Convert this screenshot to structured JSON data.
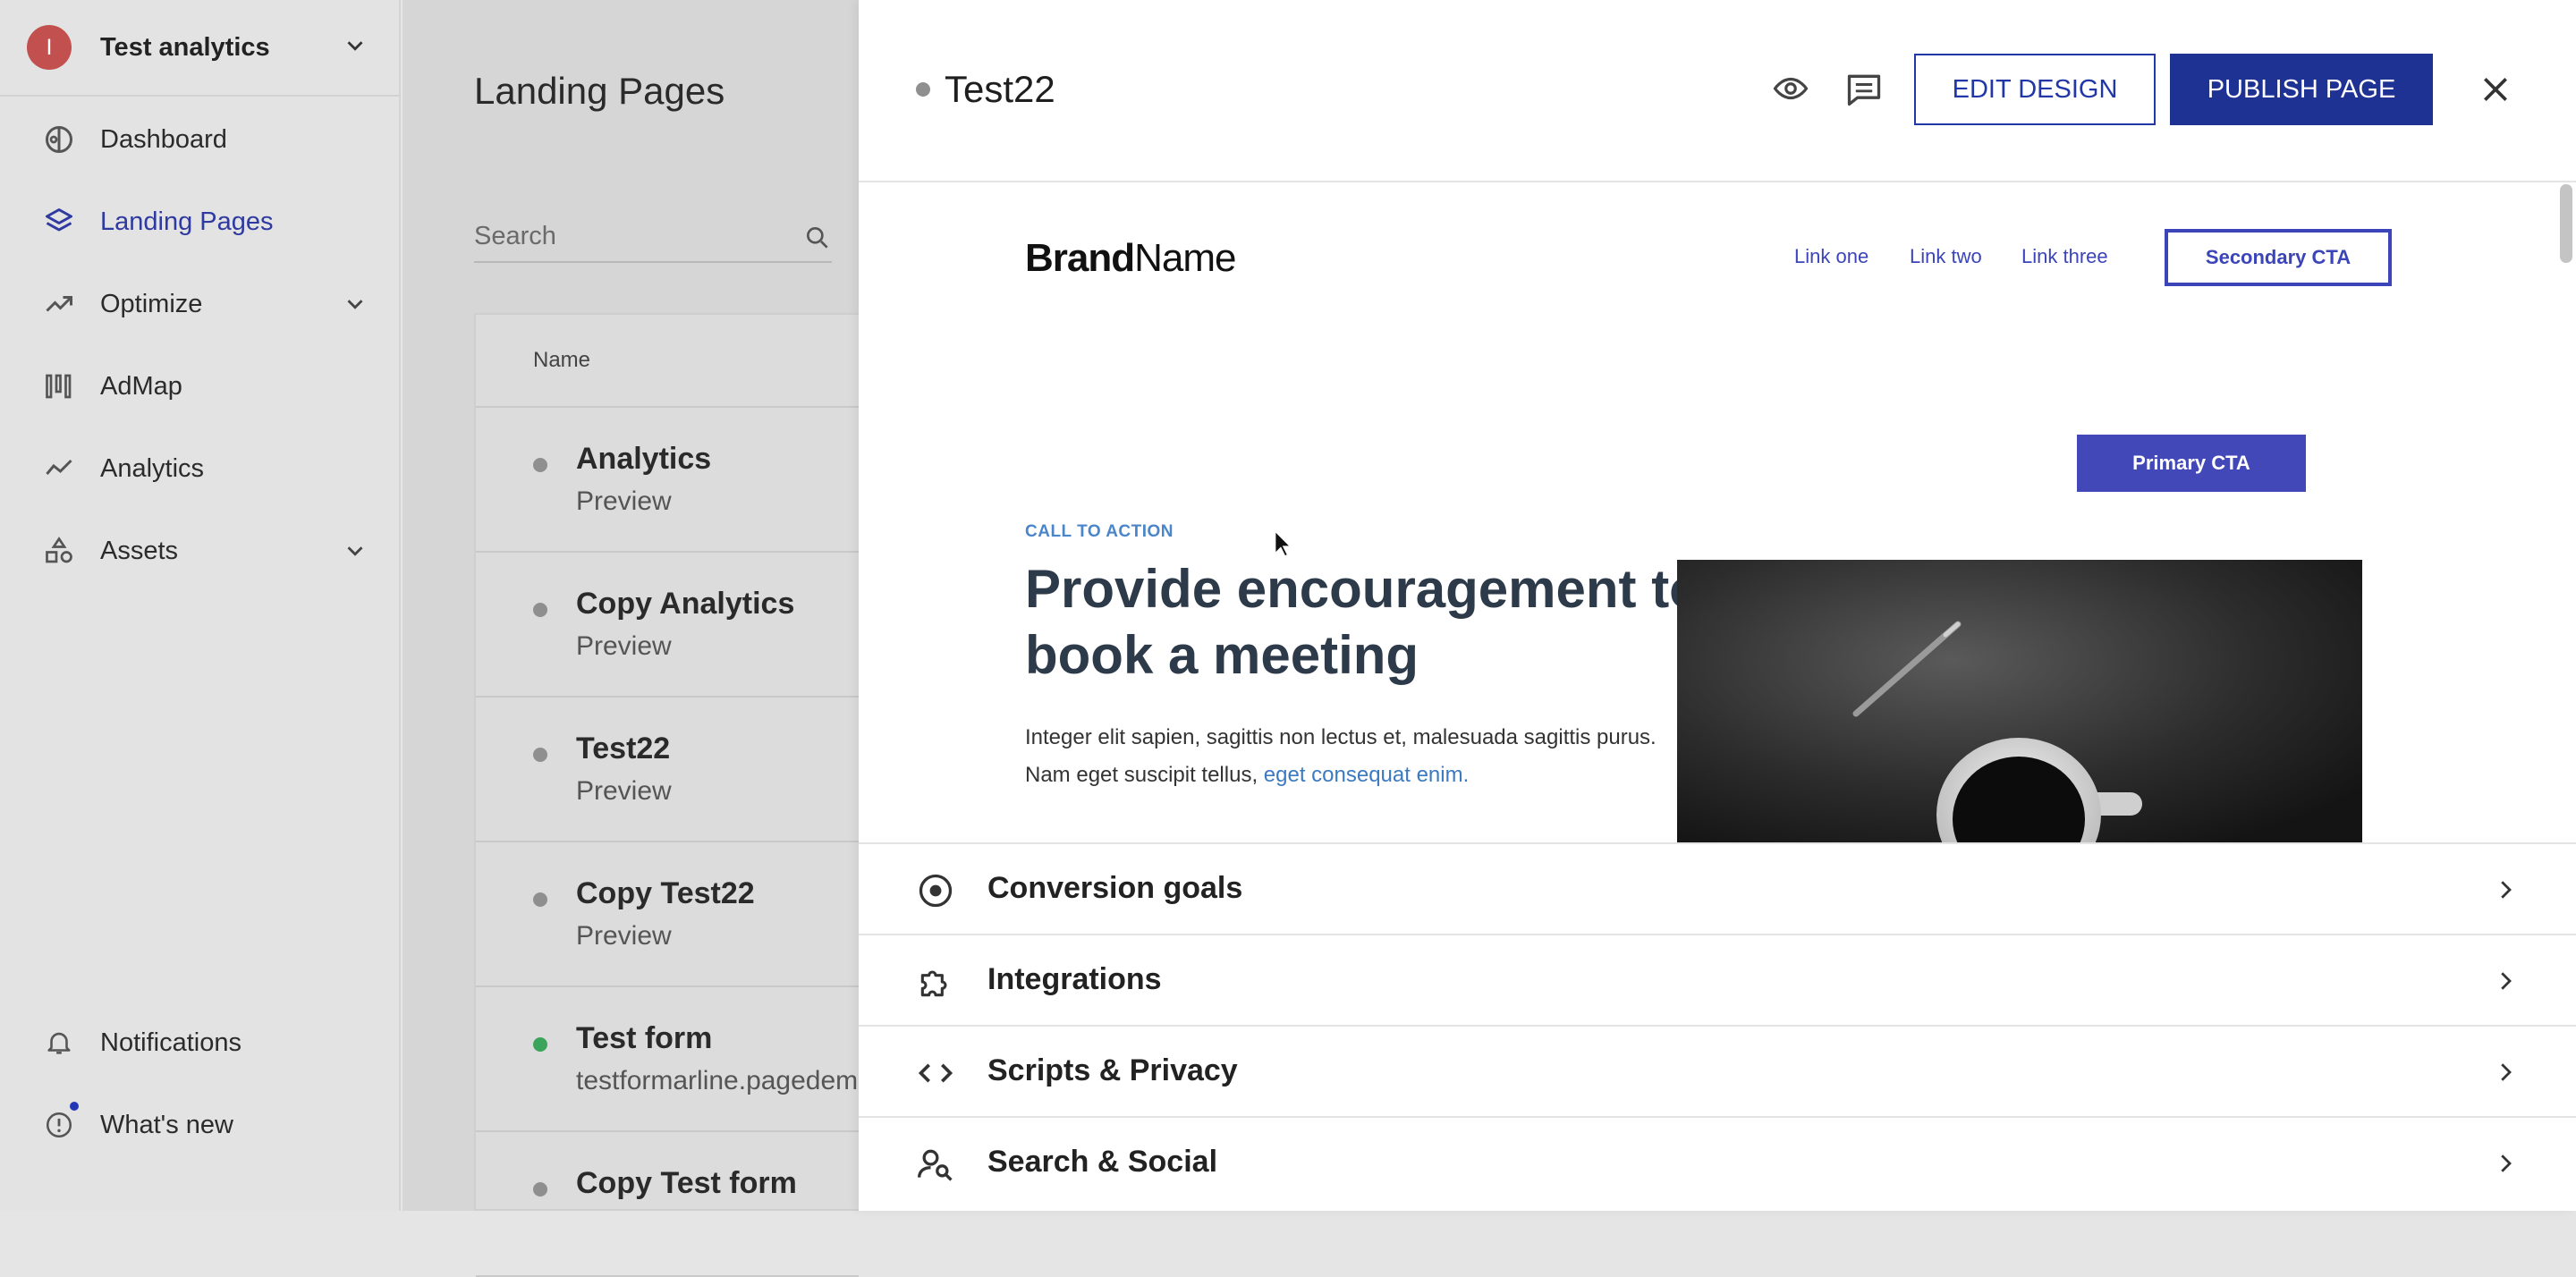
{
  "colors": {
    "accent": "#1e3294",
    "active_nav": "#2f3aa0",
    "avatar": "#c2504f",
    "status_grey": "#8f8f8f",
    "status_green": "#3aa55a"
  },
  "sidebar": {
    "workspace": {
      "initial": "I",
      "name": "Test analytics"
    },
    "items": [
      {
        "label": "Dashboard",
        "icon": "dashboard-icon"
      },
      {
        "label": "Landing Pages",
        "icon": "layers-icon",
        "active": true
      },
      {
        "label": "Optimize",
        "icon": "trend-up-icon",
        "expandable": true
      },
      {
        "label": "AdMap",
        "icon": "admap-icon"
      },
      {
        "label": "Analytics",
        "icon": "analytics-line-icon"
      },
      {
        "label": "Assets",
        "icon": "shapes-icon",
        "expandable": true
      }
    ],
    "footer": [
      {
        "label": "Notifications",
        "icon": "bell-icon"
      },
      {
        "label": "What's new",
        "icon": "info-circle-icon",
        "badge": true
      }
    ]
  },
  "list": {
    "title": "Landing Pages",
    "search_placeholder": "Search",
    "column_name": "Name",
    "rows": [
      {
        "name": "Analytics",
        "sub": "Preview",
        "status": "grey"
      },
      {
        "name": "Copy Analytics",
        "sub": "Preview",
        "status": "grey"
      },
      {
        "name": "Test22",
        "sub": "Preview",
        "status": "grey"
      },
      {
        "name": "Copy Test22",
        "sub": "Preview",
        "status": "grey"
      },
      {
        "name": "Test form",
        "sub": "testformarline.pagedem",
        "status": "green"
      },
      {
        "name": "Copy Test form",
        "sub": "",
        "status": "grey"
      }
    ]
  },
  "detail": {
    "title": "Test22",
    "edit_label": "EDIT DESIGN",
    "publish_label": "PUBLISH PAGE",
    "preview": {
      "brand_bold": "Brand",
      "brand_regular": "Name",
      "links": [
        "Link one",
        "Link two",
        "Link three"
      ],
      "secondary_cta": "Secondary CTA",
      "primary_cta": "Primary CTA",
      "eyebrow": "CALL TO ACTION",
      "headline": "Provide encouragement to book a meeting",
      "body_line1": "Integer elit sapien, sagittis non lectus et, malesuada sagittis purus.",
      "body_line2": "Nam eget suscipit tellus, ",
      "body_link": "eget consequat enim."
    },
    "sections": [
      {
        "label": "Conversion goals",
        "icon": "target-icon"
      },
      {
        "label": "Integrations",
        "icon": "puzzle-icon"
      },
      {
        "label": "Scripts & Privacy",
        "icon": "code-icon"
      },
      {
        "label": "Search & Social",
        "icon": "person-search-icon"
      }
    ]
  }
}
